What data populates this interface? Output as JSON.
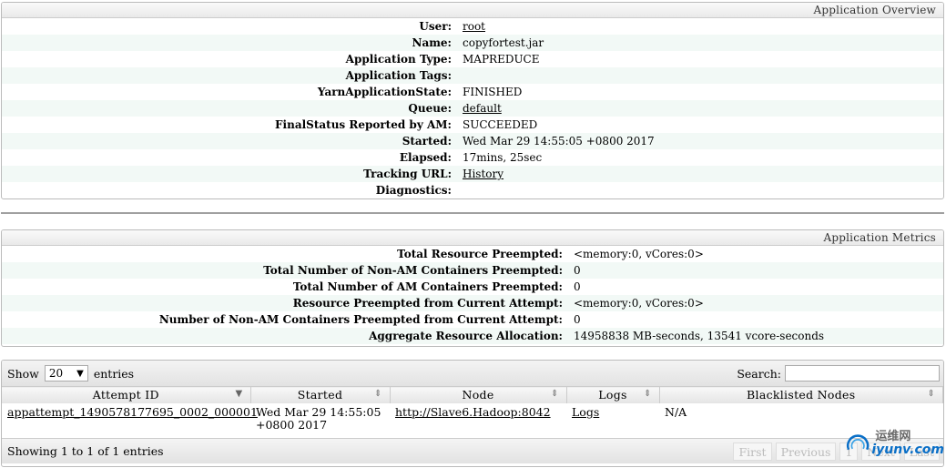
{
  "overview": {
    "title": "Application Overview",
    "rows": [
      {
        "label": "User:",
        "value": "root",
        "link": true
      },
      {
        "label": "Name:",
        "value": "copyfortest.jar",
        "link": false
      },
      {
        "label": "Application Type:",
        "value": "MAPREDUCE",
        "link": false
      },
      {
        "label": "Application Tags:",
        "value": "",
        "link": false
      },
      {
        "label": "YarnApplicationState:",
        "value": "FINISHED",
        "link": false
      },
      {
        "label": "Queue:",
        "value": "default",
        "link": true
      },
      {
        "label": "FinalStatus Reported by AM:",
        "value": "SUCCEEDED",
        "link": false
      },
      {
        "label": "Started:",
        "value": "Wed Mar 29 14:55:05 +0800 2017",
        "link": false
      },
      {
        "label": "Elapsed:",
        "value": "17mins, 25sec",
        "link": false
      },
      {
        "label": "Tracking URL:",
        "value": "History",
        "link": true
      },
      {
        "label": "Diagnostics:",
        "value": "",
        "link": false
      }
    ]
  },
  "metrics": {
    "title": "Application Metrics",
    "rows": [
      {
        "label": "Total Resource Preempted:",
        "value": "<memory:0, vCores:0>"
      },
      {
        "label": "Total Number of Non-AM Containers Preempted:",
        "value": "0"
      },
      {
        "label": "Total Number of AM Containers Preempted:",
        "value": "0"
      },
      {
        "label": "Resource Preempted from Current Attempt:",
        "value": "<memory:0, vCores:0>"
      },
      {
        "label": "Number of Non-AM Containers Preempted from Current Attempt:",
        "value": "0"
      },
      {
        "label": "Aggregate Resource Allocation:",
        "value": "14958838 MB-seconds, 13541 vcore-seconds"
      }
    ]
  },
  "attempts": {
    "show_label": "Show",
    "page_size": "20",
    "entries_label": "entries",
    "search_label": "Search:",
    "search_value": "",
    "columns": [
      "Attempt ID",
      "Started",
      "Node",
      "Logs",
      "Blacklisted Nodes"
    ],
    "rows": [
      {
        "attempt_id": "appattempt_1490578177695_0002_000001",
        "started": "Wed Mar 29 14:55:05 +0800 2017",
        "node": "http://Slave6.Hadoop:8042",
        "logs": "Logs",
        "blacklisted": "N/A"
      }
    ],
    "footer_text": "Showing 1 to 1 of 1 entries",
    "pager": {
      "first": "First",
      "previous": "Previous",
      "page": "1",
      "next": "Next",
      "last": "Last"
    }
  },
  "watermark": {
    "cn": "运维网",
    "en": "iyunv.com"
  }
}
